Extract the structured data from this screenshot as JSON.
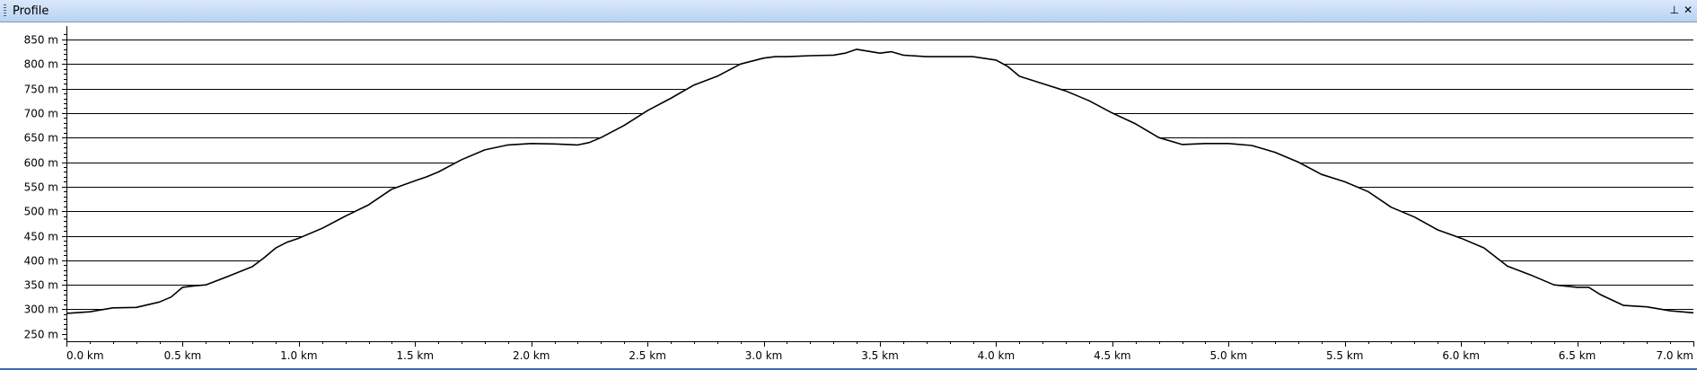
{
  "window": {
    "title": "Profile",
    "pin_icon": "pin-icon",
    "close_icon": "close-icon",
    "pin_glyph": "⊥",
    "close_glyph": "✕"
  },
  "chart_data": {
    "type": "area",
    "x_unit": "km",
    "y_unit": "m",
    "xlim": [
      0,
      7.0
    ],
    "ylim": [
      235,
      870
    ],
    "x_ticks": [
      0,
      0.5,
      1.0,
      1.5,
      2.0,
      2.5,
      3.0,
      3.5,
      4.0,
      4.5,
      5.0,
      5.5,
      6.0,
      6.5,
      7.0
    ],
    "x_tick_labels": [
      "0.0 km",
      "0.5 km",
      "1.0 km",
      "1.5 km",
      "2.0 km",
      "2.5 km",
      "3.0 km",
      "3.5 km",
      "4.0 km",
      "4.5 km",
      "5.0 km",
      "5.5 km",
      "6.0 km",
      "6.5 km",
      "7.0 km"
    ],
    "y_ticks": [
      250,
      300,
      350,
      400,
      450,
      500,
      550,
      600,
      650,
      700,
      750,
      800,
      850
    ],
    "y_tick_labels": [
      "250 m",
      "300 m",
      "350 m",
      "400 m",
      "450 m",
      "500 m",
      "550 m",
      "600 m",
      "650 m",
      "700 m",
      "750 m",
      "800 m",
      "850 m"
    ],
    "grid": "horizontal",
    "series": [
      {
        "x": [
          0,
          0.1,
          0.2,
          0.3,
          0.4,
          0.45,
          0.5,
          0.55,
          0.6,
          0.7,
          0.8,
          0.85,
          0.9,
          0.95,
          1.0,
          1.1,
          1.2,
          1.3,
          1.4,
          1.5,
          1.55,
          1.6,
          1.7,
          1.8,
          1.9,
          2.0,
          2.1,
          2.2,
          2.25,
          2.3,
          2.4,
          2.5,
          2.6,
          2.7,
          2.8,
          2.9,
          3.0,
          3.05,
          3.1,
          3.2,
          3.3,
          3.35,
          3.4,
          3.5,
          3.55,
          3.6,
          3.7,
          3.8,
          3.9,
          4.0,
          4.05,
          4.1,
          4.2,
          4.3,
          4.4,
          4.5,
          4.6,
          4.7,
          4.8,
          4.9,
          5.0,
          5.1,
          5.2,
          5.3,
          5.4,
          5.5,
          5.6,
          5.7,
          5.8,
          5.9,
          6.0,
          6.1,
          6.2,
          6.3,
          6.4,
          6.5,
          6.55,
          6.6,
          6.7,
          6.8,
          6.9,
          7.0
        ],
        "y": [
          292,
          295,
          303,
          304,
          315,
          325,
          345,
          348,
          350,
          368,
          387,
          405,
          425,
          437,
          445,
          465,
          490,
          513,
          545,
          562,
          570,
          580,
          605,
          625,
          635,
          638,
          637,
          635,
          640,
          650,
          675,
          705,
          730,
          757,
          775,
          800,
          812,
          815,
          815,
          817,
          818,
          822,
          830,
          822,
          825,
          818,
          815,
          815,
          815,
          808,
          795,
          775,
          760,
          745,
          725,
          700,
          678,
          650,
          636,
          638,
          638,
          634,
          620,
          600,
          575,
          560,
          540,
          508,
          488,
          462,
          445,
          425,
          388,
          370,
          350,
          345,
          345,
          330,
          308,
          305,
          297,
          293
        ]
      }
    ]
  }
}
